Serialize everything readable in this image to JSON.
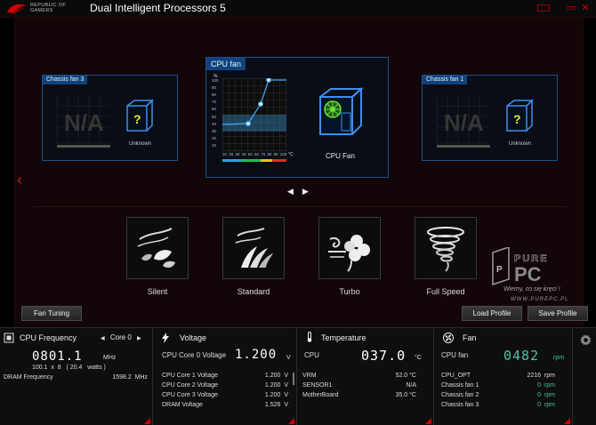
{
  "app": {
    "brand_line1": "REPUBLIC OF",
    "brand_line2": "GAMERS",
    "title": "Dual Intelligent Processors 5"
  },
  "fans": {
    "chassis3": {
      "label": "Chassis fan 3",
      "status": "N/A",
      "device": "Unknown"
    },
    "cpu": {
      "label": "CPU fan",
      "device": "CPU Fan",
      "y_axis_label": "%",
      "y_ticks": [
        "100",
        "90",
        "80",
        "70",
        "60",
        "50",
        "40",
        "30",
        "20",
        "10"
      ],
      "x_ticks": [
        "10",
        "20",
        "30",
        "40",
        "50",
        "60",
        "70",
        "80",
        "90",
        "100"
      ],
      "x_axis_label": "°C"
    },
    "chassis1": {
      "label": "Chassis fan 1",
      "status": "N/A",
      "device": "Unknown"
    }
  },
  "modes": [
    {
      "label": "Silent"
    },
    {
      "label": "Standard"
    },
    {
      "label": "Turbo"
    },
    {
      "label": "Full Speed"
    }
  ],
  "watermark": {
    "brand": "PURE PC",
    "slogan": "Wiemy, co się kręci !",
    "url": "WWW.PUREPC.PL"
  },
  "buttons": {
    "fan_tuning": "Fan Tuning",
    "load_profile": "Load Profile",
    "save_profile": "Save Profile"
  },
  "status": {
    "cpu_freq": {
      "title": "CPU Frequency",
      "core_select": "Core 0",
      "value": "0801.1",
      "unit": "MHz",
      "detail": "100.1  x  8   ( 20.4   watts )",
      "dram_label": "DRAM Frequency",
      "dram_value": "1598.2  MHz"
    },
    "voltage": {
      "title": "Voltage",
      "main_label": "CPU Core 0 Voltage",
      "main_value": "1.200",
      "main_unit": "V",
      "rows": [
        {
          "label": "CPU Core 1 Voltage",
          "value": "1.200  V"
        },
        {
          "label": "CPU Core 2 Voltage",
          "value": "1.200  V"
        },
        {
          "label": "CPU Core 3 Voltage",
          "value": "1.200  V"
        },
        {
          "label": "DRAM Voltage",
          "value": "1.526  V"
        }
      ]
    },
    "temperature": {
      "title": "Temperature",
      "main_label": "CPU",
      "main_value": "037.0",
      "main_unit": "°C",
      "rows": [
        {
          "label": "VRM",
          "value": "52.0 °C"
        },
        {
          "label": "SENSOR1",
          "value": "N/A"
        },
        {
          "label": "MotherBoard",
          "value": "35.0 °C"
        }
      ]
    },
    "fan": {
      "title": "Fan",
      "main_label": "CPU fan",
      "main_value": "0482",
      "main_unit": "rpm",
      "rows": [
        {
          "label": "CPU_OPT",
          "value": "2216  rpm"
        },
        {
          "label": "Chassis fan 1",
          "value": "0  rpm"
        },
        {
          "label": "Chassis fan 2",
          "value": "0  rpm"
        },
        {
          "label": "Chassis fan 3",
          "value": "0  rpm"
        }
      ]
    }
  },
  "colors": {
    "accent_red": "#c00000",
    "panel_blue": "#1f4f88",
    "teal": "#4fc3a3"
  }
}
